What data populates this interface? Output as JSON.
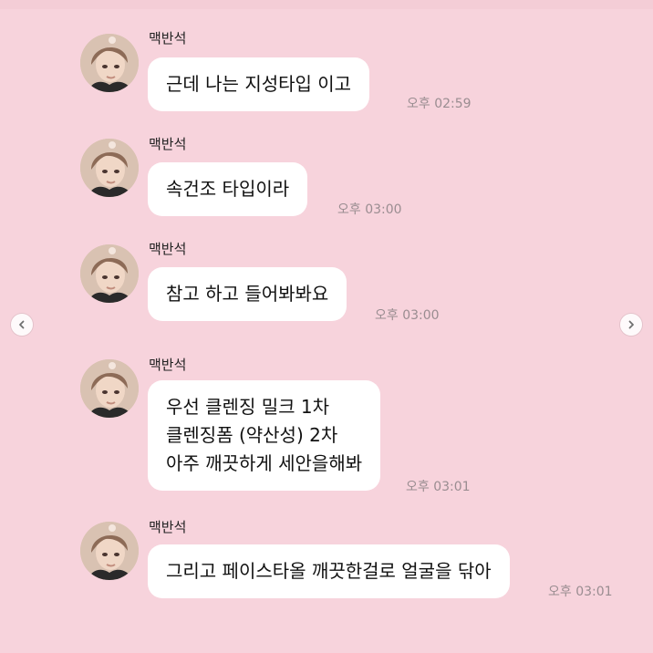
{
  "chat": {
    "messages": [
      {
        "sender": "맥반석",
        "lines": [
          "근데 나는 지성타입 이고"
        ],
        "time": "오후 02:59"
      },
      {
        "sender": "맥반석",
        "lines": [
          "속건조 타입이라"
        ],
        "time": "오후 03:00"
      },
      {
        "sender": "맥반석",
        "lines": [
          "참고 하고 들어봐봐요"
        ],
        "time": "오후 03:00"
      },
      {
        "sender": "맥반석",
        "lines": [
          "우선 클렌징 밀크 1차",
          "클렌징폼 (약산성) 2차",
          "아주 깨끗하게 세안을해봐"
        ],
        "time": "오후 03:01"
      },
      {
        "sender": "맥반석",
        "lines": [
          "그리고 페이스타올 깨끗한걸로 얼굴을 닦아"
        ],
        "time": "오후 03:01"
      }
    ]
  },
  "nav": {
    "prev_icon": "chevron-left-icon",
    "next_icon": "chevron-right-icon"
  },
  "colors": {
    "background": "#f7d3dc",
    "bubble": "#ffffff",
    "time": "#9a8d91"
  }
}
